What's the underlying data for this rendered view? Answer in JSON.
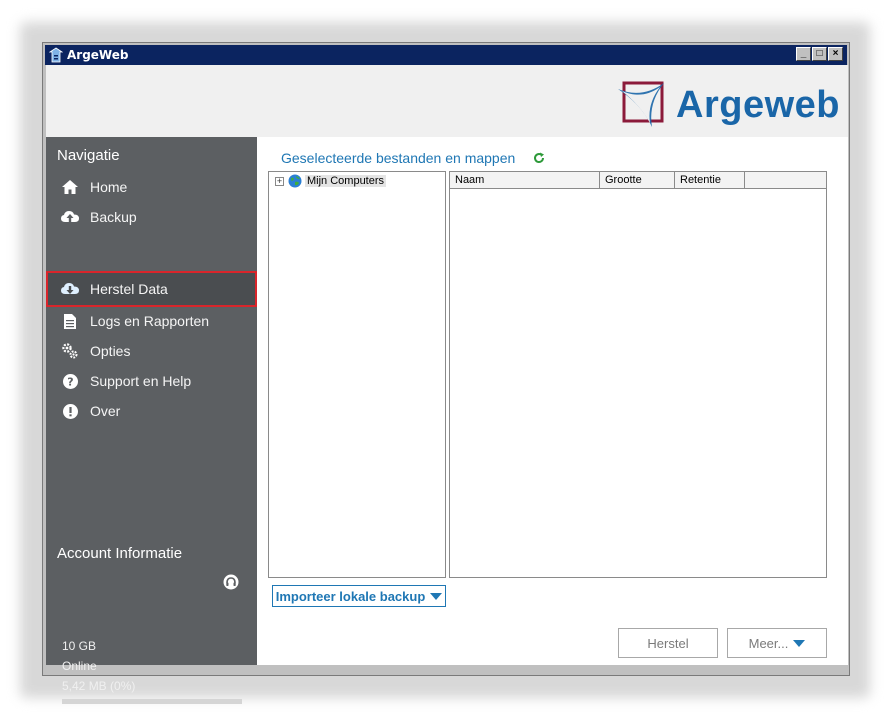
{
  "window": {
    "title": "ArgeWeb",
    "controls": [
      "minimize",
      "maximize",
      "close"
    ]
  },
  "brand": {
    "name": "Argeweb",
    "color": "#1a66a8",
    "mark_color": "#8b1a3a"
  },
  "sidebar": {
    "title": "Navigatie",
    "items": [
      {
        "label": "Home",
        "icon": "home-icon"
      },
      {
        "label": "Backup",
        "icon": "cloud-upload-icon"
      },
      {
        "label": "Herstel Data",
        "icon": "cloud-download-icon",
        "active": true
      },
      {
        "label": "Logs en Rapporten",
        "icon": "document-icon"
      },
      {
        "label": "Opties",
        "icon": "gears-icon"
      },
      {
        "label": "Support en Help",
        "icon": "question-icon"
      },
      {
        "label": "Over",
        "icon": "info-exclamation-icon"
      }
    ],
    "account": {
      "title": "Account Informatie",
      "quota": "10 GB",
      "status": "Online",
      "used": "5,42 MB (0%)",
      "used_fraction": 0.0,
      "support_icon": "headset-icon"
    }
  },
  "main": {
    "heading": "Geselecteerde bestanden en mappen",
    "refresh_icon": "refresh-icon",
    "tree": {
      "root_label": "Mijn Computers",
      "expander": "+"
    },
    "list": {
      "columns": [
        "Naam",
        "Grootte",
        "Retentie"
      ]
    },
    "import_button": "Importeer lokale backup",
    "restore_button": "Herstel",
    "more_button": "Meer..."
  },
  "colors": {
    "accent": "#1f77b4",
    "sidebar_bg": "#5c5f62",
    "active_outline": "#d9252b",
    "titlebar": "#0b2460"
  }
}
